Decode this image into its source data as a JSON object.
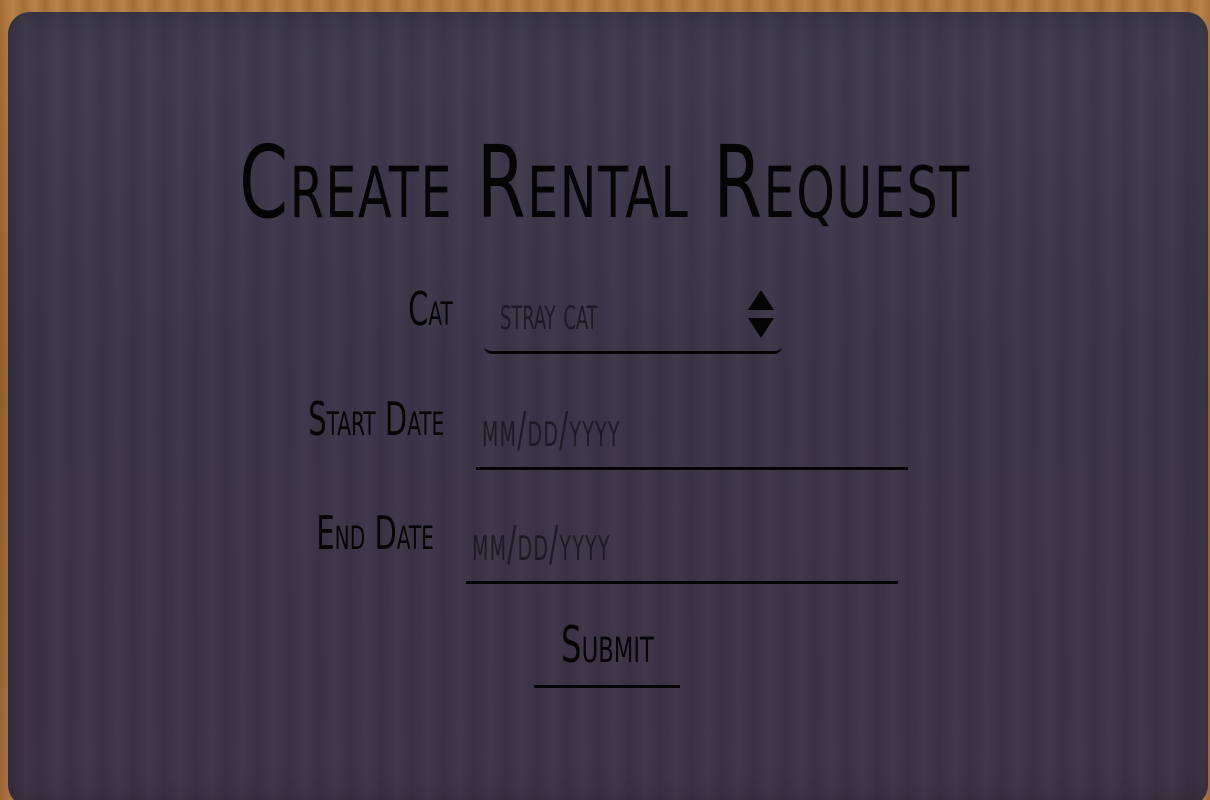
{
  "form": {
    "title": "Create Rental Request",
    "cat": {
      "label": "Cat",
      "selected_value": "stray cat"
    },
    "start_date": {
      "label": "Start Date",
      "placeholder": "mm/dd/yyyy"
    },
    "end_date": {
      "label": "End Date",
      "placeholder": "mm/dd/yyyy"
    },
    "submit_label": "Submit"
  },
  "colors": {
    "background_wood": "#a06a36",
    "panel": "#3c3749",
    "text": "#050505"
  }
}
